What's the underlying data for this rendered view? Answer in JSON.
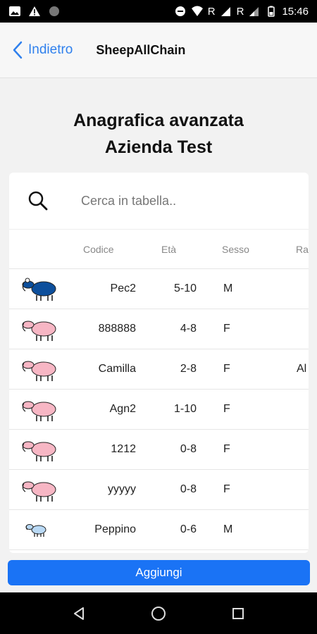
{
  "status_bar": {
    "time": "15:46",
    "network_r1": "R",
    "network_r2": "R"
  },
  "nav": {
    "back_label": "Indietro",
    "title": "SheepAllChain"
  },
  "page": {
    "title_line1": "Anagrafica avanzata",
    "title_line2": "Azienda Test"
  },
  "search": {
    "placeholder": "Cerca in tabella.."
  },
  "table": {
    "headers": {
      "code": "Codice",
      "age": "Età",
      "sex": "Sesso",
      "breed": "Ra"
    },
    "rows": [
      {
        "icon": "sheep-blue-icon",
        "code": "Pec2",
        "age": "5-10",
        "sex": "M",
        "breed": ""
      },
      {
        "icon": "sheep-pink-icon",
        "code": "888888",
        "age": "4-8",
        "sex": "F",
        "breed": ""
      },
      {
        "icon": "sheep-pink-icon",
        "code": "Camilla",
        "age": "2-8",
        "sex": "F",
        "breed": "Al"
      },
      {
        "icon": "sheep-pink-icon",
        "code": "Agn2",
        "age": "1-10",
        "sex": "F",
        "breed": ""
      },
      {
        "icon": "sheep-pink-icon",
        "code": "1212",
        "age": "0-8",
        "sex": "F",
        "breed": ""
      },
      {
        "icon": "sheep-pink-icon",
        "code": "yyyyy",
        "age": "0-8",
        "sex": "F",
        "breed": ""
      },
      {
        "icon": "lamb-blue-icon",
        "code": "Peppino",
        "age": "0-6",
        "sex": "M",
        "breed": ""
      }
    ]
  },
  "footer": {
    "add_label": "Aggiungi"
  },
  "colors": {
    "accent": "#1a73f5",
    "link": "#2f80ed",
    "sheep_blue": "#0d4f9c",
    "sheep_pink": "#f7b6c4",
    "lamb_blue": "#b9d9f5"
  }
}
